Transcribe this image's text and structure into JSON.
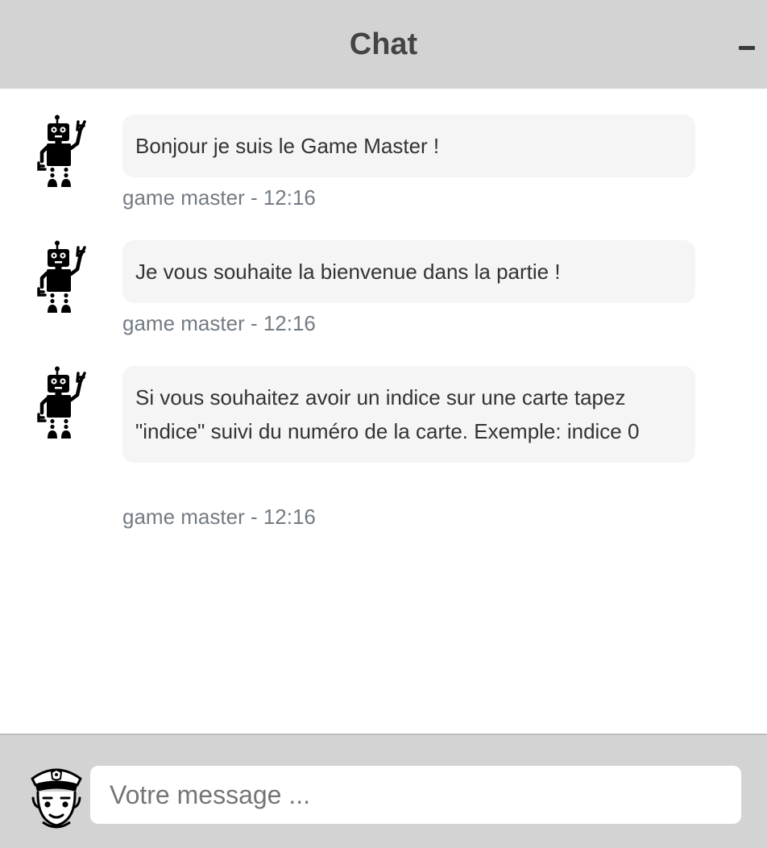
{
  "header": {
    "title": "Chat",
    "minimize_icon": "minus-icon"
  },
  "messages": [
    {
      "avatar_icon": "robot-icon",
      "text": "Bonjour je suis le Game Master !",
      "meta": "game master - 12:16"
    },
    {
      "avatar_icon": "robot-icon",
      "text": "Je vous souhaite la bienvenue dans la partie !",
      "meta": "game master - 12:16"
    },
    {
      "avatar_icon": "robot-icon",
      "text": "Si vous souhaitez avoir un indice sur une carte tapez \"indice\" suivi du numéro de la carte. Exemple: indice 0",
      "meta": "game master - 12:16"
    }
  ],
  "composer": {
    "user_avatar_icon": "police-officer-icon",
    "placeholder": "Votre message ...",
    "value": ""
  },
  "colors": {
    "header_bg": "#d3d3d3",
    "bubble_bg": "#f5f5f5",
    "meta_text": "#737b83",
    "input_bg": "#ffffff"
  }
}
